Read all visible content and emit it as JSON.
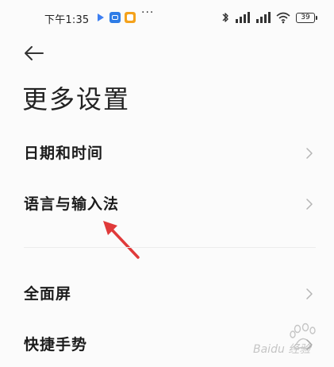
{
  "status_bar": {
    "time": "下午1:35",
    "more": "···",
    "battery": "39",
    "icons": [
      "play-icon",
      "app-icon",
      "notes-icon",
      "bluetooth-icon",
      "signal-icon",
      "signal-icon",
      "wifi-icon",
      "battery-icon"
    ]
  },
  "header": {
    "back_icon": "arrow-left-icon",
    "title": "更多设置"
  },
  "list": {
    "items": [
      {
        "label": "日期和时间"
      },
      {
        "label": "语言与输入法"
      },
      {
        "label": "全面屏"
      },
      {
        "label": "快捷手势"
      }
    ]
  },
  "annotation": {
    "color": "#e03a3a",
    "icon": "red-arrow-annotation"
  },
  "watermark": {
    "text": "Baidu 经验",
    "icon": "baidu-paw-logo"
  },
  "colors": {
    "background": "#fbfbfb",
    "text": "#1c1c1c",
    "chevron": "#b5b5b5",
    "divider": "#ececec"
  }
}
